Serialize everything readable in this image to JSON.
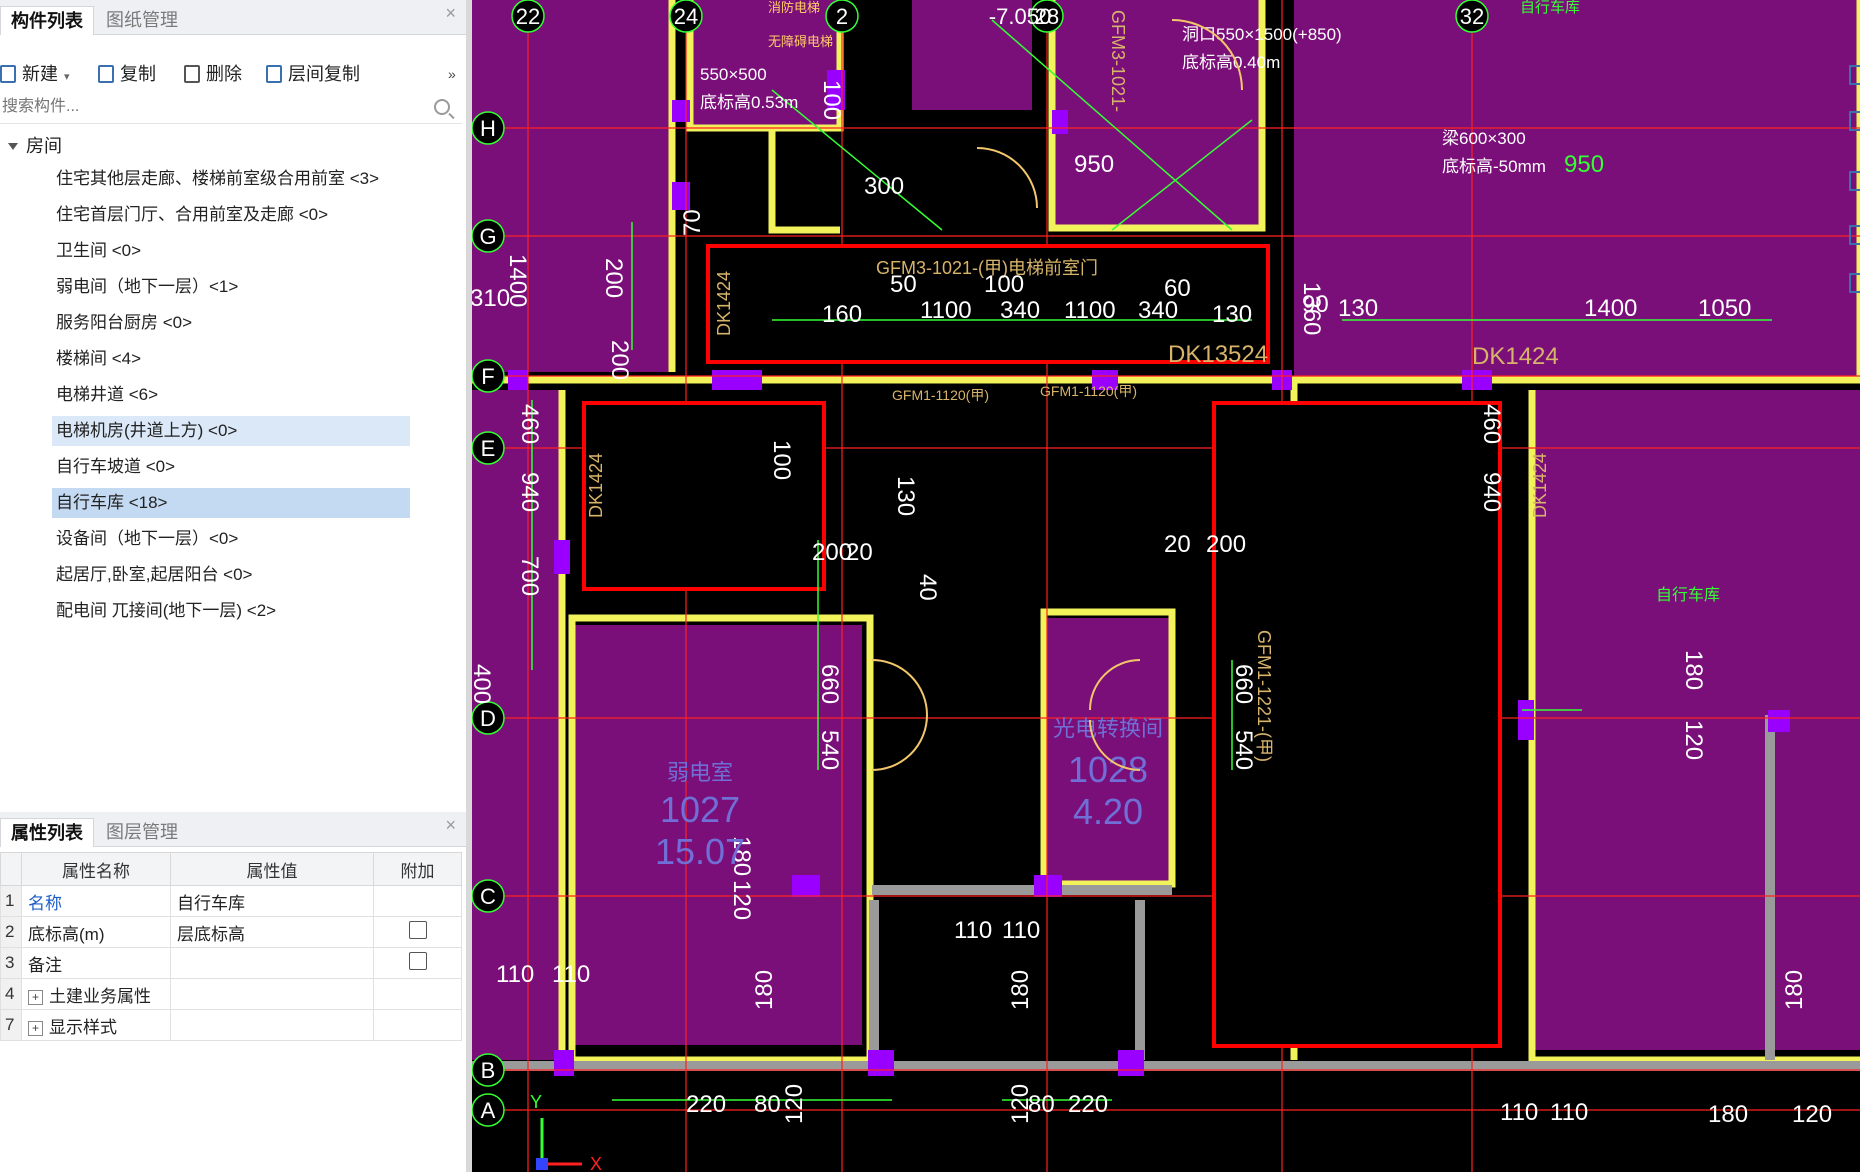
{
  "top_panel": {
    "tabs": [
      "构件列表",
      "图纸管理"
    ],
    "close": "×"
  },
  "toolbar": {
    "new": "新建",
    "copy": "复制",
    "delete": "删除",
    "floor_copy": "层间复制",
    "more": "»"
  },
  "search": {
    "placeholder": "搜索构件..."
  },
  "tree": {
    "root": "房间",
    "items": [
      "住宅其他层走廊、楼梯前室级合用前室 <3>",
      "住宅首层门厅、合用前室及走廊 <0>",
      "卫生间 <0>",
      "弱电间（地下一层）<1>",
      "服务阳台厨房 <0>",
      "楼梯间 <4>",
      "电梯井道 <6>",
      "电梯机房(井道上方) <0>",
      "自行车坡道 <0>",
      "自行车库 <18>",
      "设备间（地下一层）<0>",
      "起居厅,卧室,起居阳台 <0>",
      "配电间 兀接间(地下一层) <2>"
    ]
  },
  "props_panel": {
    "tabs": [
      "属性列表",
      "图层管理"
    ],
    "close": "×",
    "headers": [
      "属性名称",
      "属性值",
      "附加"
    ],
    "rows": [
      {
        "num": "1",
        "name": "名称",
        "value": "自行车库"
      },
      {
        "num": "2",
        "name": "底标高(m)",
        "value": "层底标高"
      },
      {
        "num": "3",
        "name": "备注",
        "value": ""
      },
      {
        "num": "4",
        "name": "土建业务属性",
        "value": ""
      },
      {
        "num": "7",
        "name": "显示样式",
        "value": ""
      }
    ]
  },
  "drawing": {
    "grid_labels_top": [
      "22",
      "24",
      "2",
      "28",
      "32"
    ],
    "grid_labels_left": [
      "H",
      "G",
      "F",
      "E",
      "D",
      "C",
      "B",
      "A"
    ],
    "level": "-7.050",
    "room_labels": [
      {
        "name": "弱电室",
        "code": "1027",
        "area": "15.07"
      },
      {
        "name": "光电转换间",
        "code": "1028",
        "area": "4.20"
      }
    ],
    "bike_label": "自行车库",
    "door_labels": [
      "GFM3-1021-(甲)电梯前室门",
      "GFM1-1120(甲)",
      "GFM1-1120(甲)",
      "GFM1-1221-(甲)",
      "GFM3-1021-",
      "DK1424",
      "DK1424",
      "DK1424",
      "DK1424",
      "DK13524"
    ],
    "text_notes": [
      "洞口550×1500(+850)",
      "底标高0.40m",
      "550×500",
      "底标高0.53m",
      "梁600×300",
      "底标高-50mm",
      "消防电梯",
      "无障碍电梯"
    ],
    "dimensions": [
      "50",
      "100",
      "60",
      "130",
      "1100",
      "340",
      "160",
      "1360",
      "90",
      "1400",
      "1050",
      "950",
      "300",
      "200",
      "20",
      "460",
      "940",
      "700",
      "660",
      "540",
      "180",
      "120",
      "110",
      "220",
      "80",
      "310",
      "400",
      "70",
      "20",
      "40"
    ],
    "axis_x": "X",
    "axis_y": "Y",
    "colors": {
      "room": "#7a0f7a",
      "wall": "#f2f25a",
      "column": "#9900ff",
      "grid": "#ff2020",
      "dim": "#33ff33",
      "highlight": "#ff0000"
    }
  }
}
